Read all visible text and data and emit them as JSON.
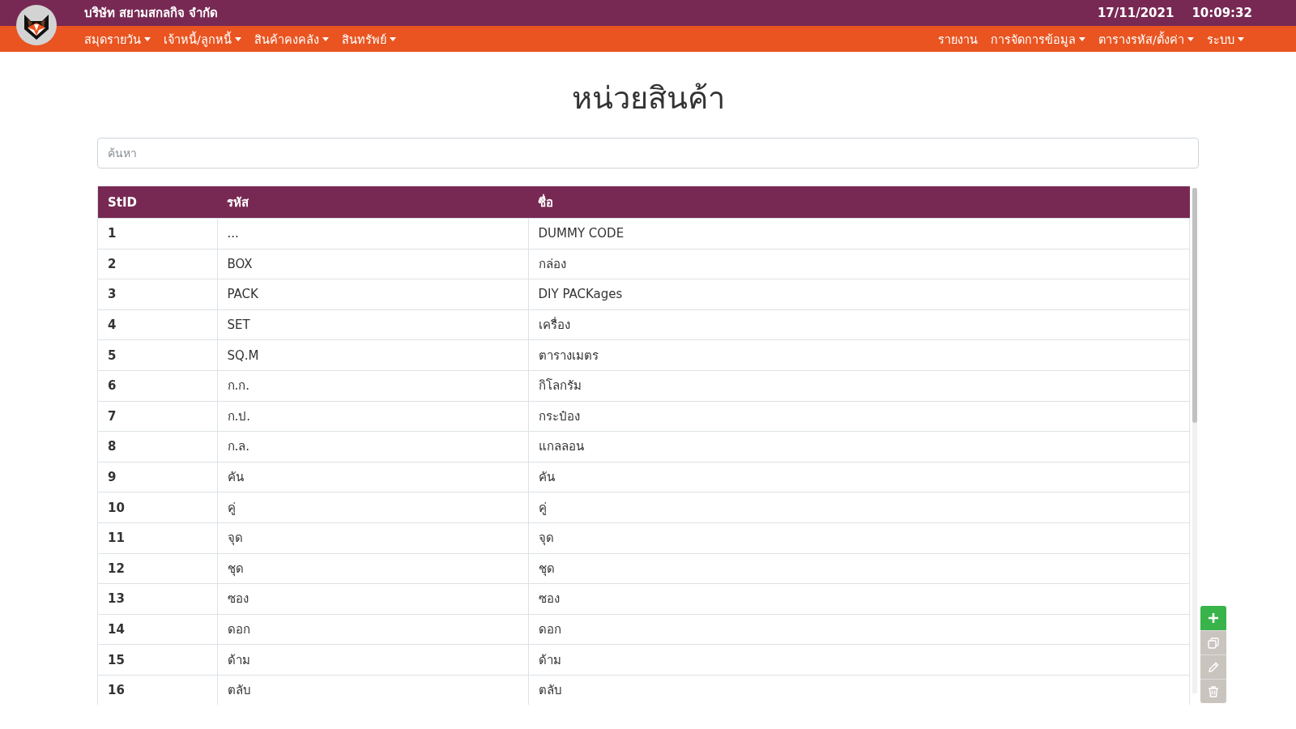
{
  "header": {
    "company": "บริษัท สยามสกลกิจ จำกัด",
    "date": "17/11/2021",
    "time": "10:09:32"
  },
  "menu_left": [
    {
      "label": "สมุดรายวัน",
      "dropdown": true
    },
    {
      "label": "เจ้าหนี้/ลูกหนี้",
      "dropdown": true
    },
    {
      "label": "สินค้าคงคลัง",
      "dropdown": true
    },
    {
      "label": "สินทรัพย์",
      "dropdown": true
    }
  ],
  "menu_right": [
    {
      "label": "รายงาน",
      "dropdown": false
    },
    {
      "label": "การจัดการข้อมูล",
      "dropdown": true
    },
    {
      "label": "ตารางรหัส/ตั้งค่า",
      "dropdown": true
    },
    {
      "label": "ระบบ",
      "dropdown": true
    }
  ],
  "page_title": "หน่วยสินค้า",
  "search": {
    "placeholder": "ค้นหา"
  },
  "table": {
    "columns": [
      "StID",
      "รหัส",
      "ชื่อ"
    ],
    "rows": [
      [
        "1",
        "...",
        "DUMMY CODE"
      ],
      [
        "2",
        "BOX",
        "กล่อง"
      ],
      [
        "3",
        "PACK",
        "DIY PACKages"
      ],
      [
        "4",
        "SET",
        "เครื่อง"
      ],
      [
        "5",
        "SQ.M",
        "ตารางเมตร"
      ],
      [
        "6",
        "ก.ก.",
        "กิโลกรัม"
      ],
      [
        "7",
        "ก.ป.",
        "กระป๋อง"
      ],
      [
        "8",
        "ก.ล.",
        "แกลลอน"
      ],
      [
        "9",
        "คัน",
        "คัน"
      ],
      [
        "10",
        "คู่",
        "คู่"
      ],
      [
        "11",
        "จุด",
        "จุด"
      ],
      [
        "12",
        "ชุด",
        "ชุด"
      ],
      [
        "13",
        "ซอง",
        "ซอง"
      ],
      [
        "14",
        "ดอก",
        "ดอก"
      ],
      [
        "15",
        "ด้าม",
        "ด้าม"
      ],
      [
        "16",
        "ตลับ",
        "ตลับ"
      ]
    ]
  },
  "actions": [
    {
      "kind": "add",
      "disabled": false
    },
    {
      "kind": "copy",
      "disabled": true
    },
    {
      "kind": "edit",
      "disabled": true
    },
    {
      "kind": "delete",
      "disabled": true
    }
  ]
}
